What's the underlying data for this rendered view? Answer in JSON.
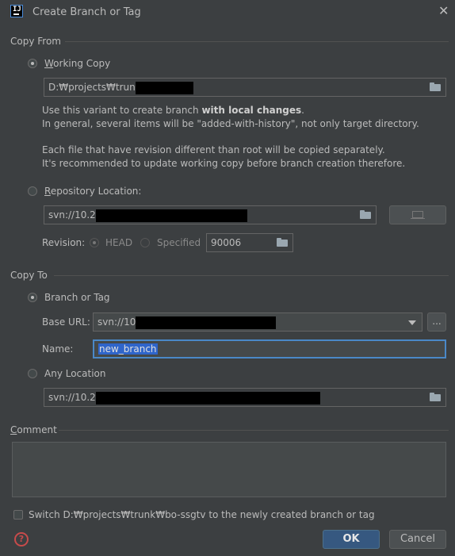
{
  "window": {
    "title": "Create Branch or Tag",
    "close_glyph": "✕",
    "app_icon_text": "IJ"
  },
  "copy_from": {
    "section_label": "Copy From",
    "working_copy": {
      "label": "Working Copy",
      "value": "D:₩projects₩trun"
    },
    "description": {
      "line1_prefix": "Use this variant to create branch ",
      "line1_bold": "with local changes",
      "line1_suffix": ".",
      "line2": "In general, several items will be \"added-with-history\", not only target directory.",
      "line3": "Each file that have revision different than root will be copied separately.",
      "line4": "It's recommended to update working copy before branch creation therefore."
    },
    "repository_location": {
      "label": "Repository Location:",
      "value": "svn://10.2"
    },
    "revision": {
      "label": "Revision:",
      "head_label": "HEAD",
      "specified_label": "Specified",
      "value": "90006"
    }
  },
  "copy_to": {
    "section_label": "Copy To",
    "branch_or_tag": {
      "label": "Branch or Tag"
    },
    "base_url": {
      "label": "Base URL:",
      "value": "svn://10",
      "browse_label": "..."
    },
    "name": {
      "label": "Name:",
      "value": "new_branch"
    },
    "any_location": {
      "label": "Any Location",
      "value": "svn://10.2"
    }
  },
  "comment": {
    "label": "Comment",
    "value": ""
  },
  "switch_checkbox": {
    "label": "Switch D:₩projects₩trunk₩bo-ssgtv to the newly created branch or tag",
    "checked": false
  },
  "buttons": {
    "ok": "OK",
    "cancel": "Cancel",
    "help": "?"
  },
  "colors": {
    "background": "#3c3f41",
    "primary_button": "#365880",
    "field": "#45494a",
    "selection": "#2f65ca",
    "focus_border": "#4a88c7"
  }
}
